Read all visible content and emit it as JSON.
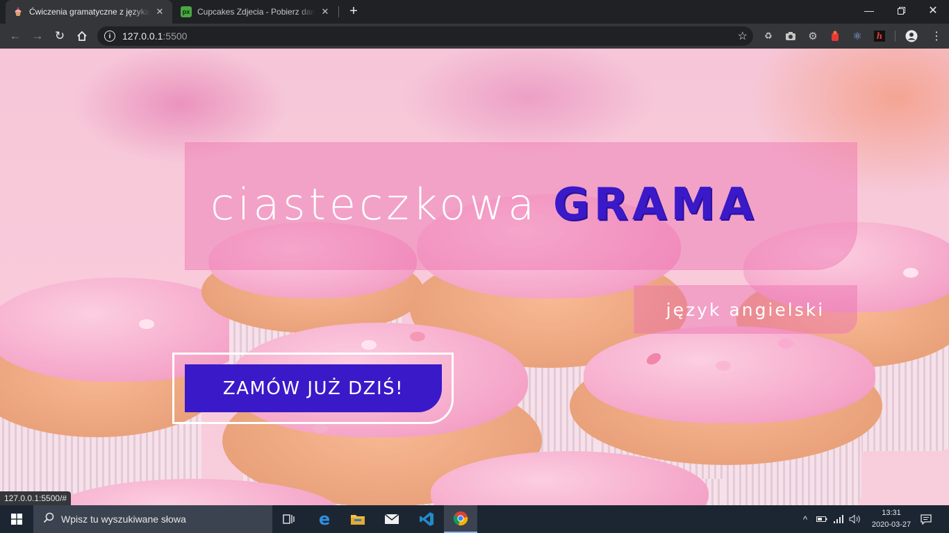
{
  "browser": {
    "tabs": [
      {
        "title": "Ćwiczenia gramatyczne z języka a",
        "favicon": "cupcake-icon",
        "active": true
      },
      {
        "title": "Cupcakes Zdjecia - Pobierz darm",
        "favicon": "px",
        "active": false
      }
    ],
    "address": {
      "host": "127.0.0.1",
      "port": ":5500"
    },
    "status_url": "127.0.0.1:5500/#"
  },
  "page": {
    "title_light": "ciasteczkowa",
    "title_strong": "GRAMA",
    "subtitle": "język angielski",
    "cta_label": "ZAMÓW JUŻ DZIŚ!",
    "colors": {
      "accent": "#3a19c8",
      "panel": "#ec6eaf"
    }
  },
  "taskbar": {
    "search_placeholder": "Wpisz tu wyszukiwane słowa",
    "time": "13:31",
    "date": "2020-03-27"
  }
}
